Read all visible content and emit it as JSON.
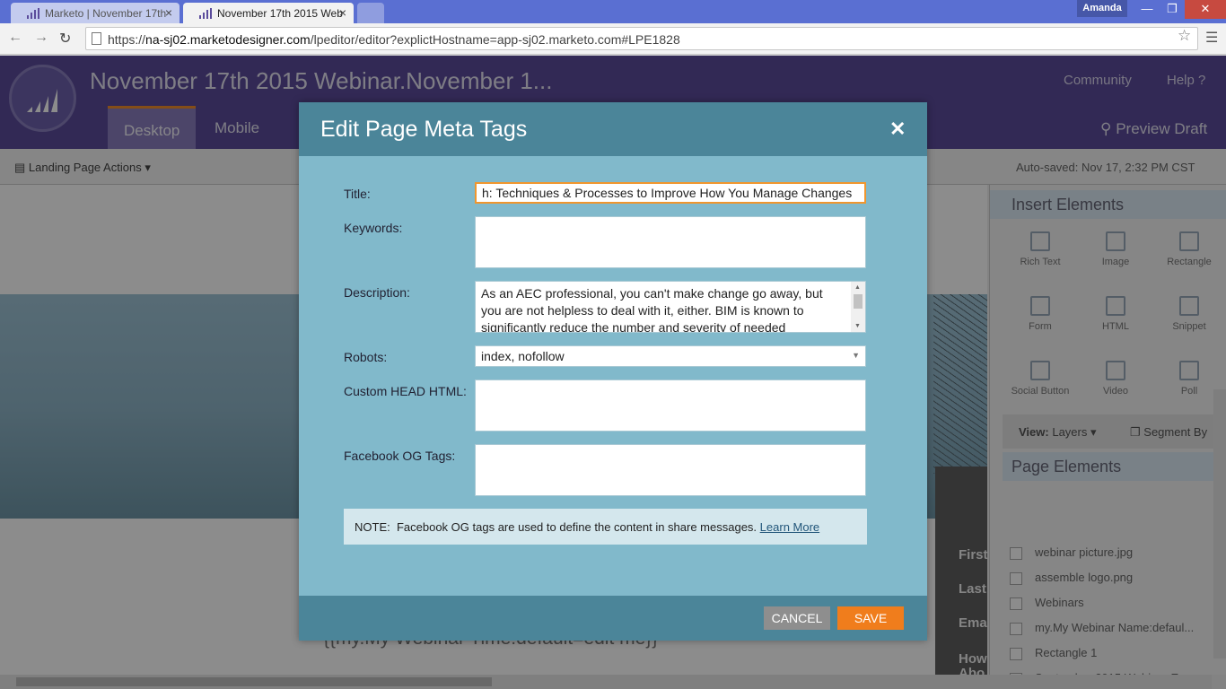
{
  "browser": {
    "tabs": [
      {
        "title": "Marketo | November 17th"
      },
      {
        "title": "November 17th 2015 Web"
      }
    ],
    "profile": "Amanda",
    "window_controls": {
      "minimize": "—",
      "maximize": "❐",
      "close": "✕"
    },
    "url_scheme": "https://",
    "url_host": "na-sj02.marketodesigner.com",
    "url_path": "/lpeditor/editor?explictHostname=app-sj02.marketo.com#LPE1828"
  },
  "app": {
    "title": "November 17th 2015 Webinar.November 1...",
    "header_links": {
      "community": "Community",
      "help": "Help"
    },
    "subnav": {
      "desktop": "Desktop",
      "mobile": "Mobile",
      "preview": "Preview Draft"
    },
    "toolbar": {
      "actions": "Landing Page Actions",
      "autosaved": "Auto-saved: Nov 17, 2:32 PM CST"
    },
    "canvas_text": "{{my.My Webinar Time:default=edit me}}",
    "form_labels": [
      "First",
      "Last",
      "Ema",
      "How",
      "Abo"
    ]
  },
  "insert_elements": {
    "title": "Insert Elements",
    "tiles": [
      "Rich Text",
      "Image",
      "Rectangle",
      "Form",
      "HTML",
      "Snippet",
      "Social Button",
      "Video",
      "Poll"
    ]
  },
  "view_bar": {
    "view_label": "View:",
    "view_value": "Layers",
    "segment": "Segment By"
  },
  "page_elements": {
    "title": "Page Elements",
    "items": [
      "webinar picture.jpg",
      "assemble logo.png",
      "Webinars",
      "my.My Webinar Name:defaul...",
      "Rectangle 1",
      "September 2015 Webinar Ev..."
    ]
  },
  "modal": {
    "title": "Edit Page Meta Tags",
    "labels": {
      "title": "Title:",
      "keywords": "Keywords:",
      "description": "Description:",
      "robots": "Robots:",
      "custom_head": "Custom HEAD HTML:",
      "facebook_og": "Facebook OG Tags:"
    },
    "values": {
      "title": "h: Techniques & Processes to Improve How You Manage Changes",
      "keywords": "",
      "description": "As an AEC professional, you can't make change go away, but you are not helpless to deal with it, either. BIM is known to significantly reduce the number and severity of needed",
      "robots": "index, nofollow",
      "custom_head": "",
      "facebook_og": ""
    },
    "note": {
      "prefix": "NOTE:",
      "text": "Facebook OG tags are used to define the content in share messages.",
      "link": "Learn More"
    },
    "buttons": {
      "cancel": "CANCEL",
      "save": "SAVE"
    }
  },
  "colors": {
    "modal_header": "#4b8599",
    "modal_body": "#81b9cb",
    "save": "#f07d1c",
    "cancel": "#8e8e8e",
    "app_header": "#5b4c9c"
  }
}
